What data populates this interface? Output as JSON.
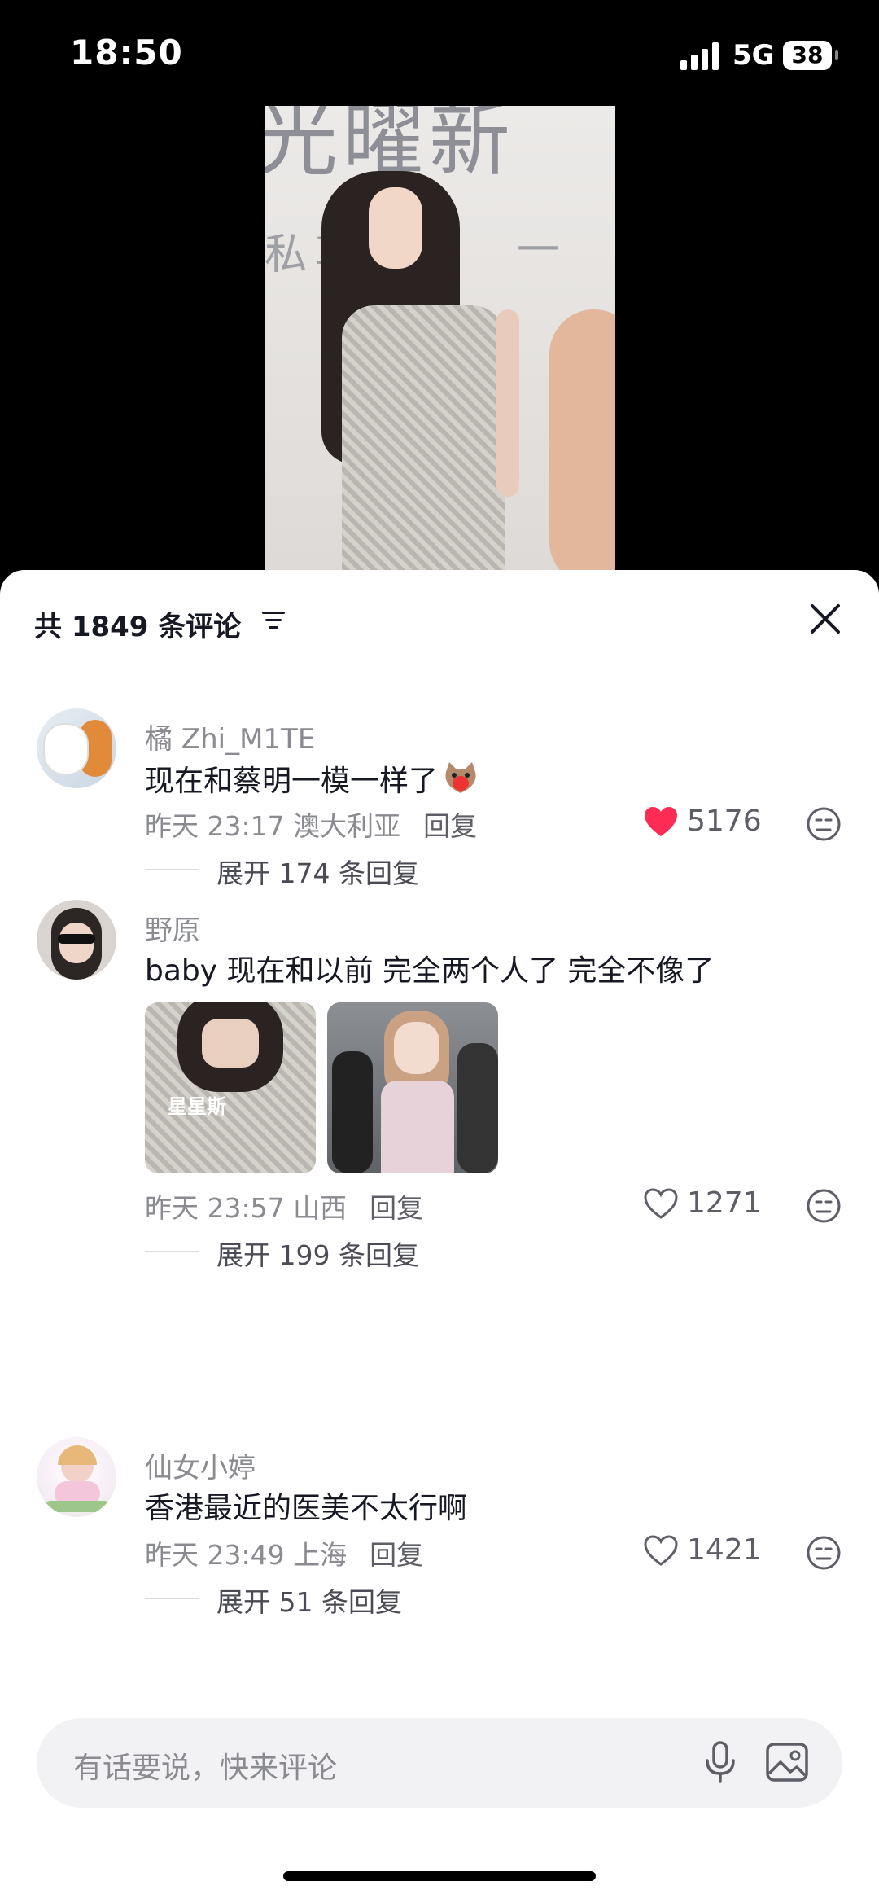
{
  "status_bar": {
    "time": "18:50",
    "network": "5G",
    "battery": "38"
  },
  "video": {
    "banner_text": "光曜新",
    "banner_sub": "私享",
    "banner_dash": "一"
  },
  "comments_header": {
    "title": "共 1849 条评论"
  },
  "comments": [
    {
      "username": "橘 Zhi_M1TE",
      "text": "现在和蔡明一模一样了",
      "date": "昨天 23:17 澳大利亚",
      "reply_label": "回复",
      "likes": "5176",
      "liked": true,
      "expand": "展开 174 条回复"
    },
    {
      "username": "野原",
      "text": "baby 现在和以前 完全两个人了 完全不像了",
      "date": "昨天 23:57 山西",
      "reply_label": "回复",
      "likes": "1271",
      "liked": false,
      "expand": "展开 199 条回复",
      "thumb_watermark": "星星斯"
    },
    {
      "username": "仙女小婷",
      "text": "香港最近的医美不太行啊",
      "date": "昨天 23:49 上海",
      "reply_label": "回复",
      "likes": "1421",
      "liked": false,
      "expand": "展开 51 条回复"
    }
  ],
  "input": {
    "placeholder": "有话要说，快来评论"
  },
  "colors": {
    "like_red": "#fe2c55",
    "text_primary": "#161823",
    "text_secondary": "#8a8b91"
  }
}
